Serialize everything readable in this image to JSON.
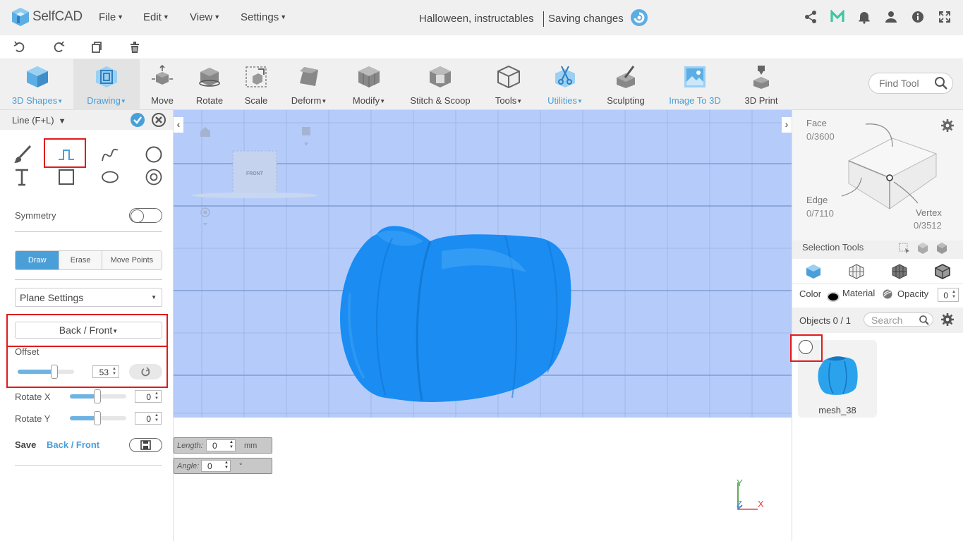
{
  "app": {
    "logo_text": "SelfCAD",
    "menus": [
      "File",
      "Edit",
      "View",
      "Settings"
    ],
    "document_title": "Halloween, instructables",
    "save_status": "Saving changes"
  },
  "ribbon": {
    "tools": [
      {
        "label": "3D Shapes",
        "dropdown": true
      },
      {
        "label": "Drawing",
        "dropdown": true
      },
      {
        "label": "Move",
        "dropdown": false
      },
      {
        "label": "Rotate",
        "dropdown": false
      },
      {
        "label": "Scale",
        "dropdown": false
      },
      {
        "label": "Deform",
        "dropdown": true
      },
      {
        "label": "Modify",
        "dropdown": true
      },
      {
        "label": "Stitch & Scoop",
        "dropdown": false
      },
      {
        "label": "Tools",
        "dropdown": true
      },
      {
        "label": "Utilities",
        "dropdown": true
      },
      {
        "label": "Sculpting",
        "dropdown": false
      },
      {
        "label": "Image To 3D",
        "dropdown": false
      },
      {
        "label": "3D Print",
        "dropdown": false
      }
    ],
    "find_tool_placeholder": "Find Tool"
  },
  "left_panel": {
    "title": "Line (F+L)",
    "symmetry_label": "Symmetry",
    "symmetry_on": false,
    "modes": [
      "Draw",
      "Erase",
      "Move Points"
    ],
    "active_mode": "Draw",
    "plane_settings": "Plane Settings",
    "plane": "Back / Front",
    "offset_label": "Offset",
    "offset_value": "53",
    "offset_fraction": 0.65,
    "rotate_x_label": "Rotate X",
    "rotate_x_value": "0",
    "rotate_y_label": "Rotate Y",
    "rotate_y_value": "0",
    "save_label": "Save",
    "save_plane": "Back / Front"
  },
  "viewport": {
    "view_cube_label": "FRONT",
    "length_label": "Length:",
    "length_value": "0",
    "length_unit": "mm",
    "angle_label": "Angle:",
    "angle_value": "0",
    "angle_unit": "°",
    "axis_y": "Y",
    "axis_z": "Z",
    "axis_x": "X"
  },
  "right_panel": {
    "face_label": "Face",
    "face_count": "0/3600",
    "edge_label": "Edge",
    "edge_count": "0/7110",
    "vertex_label": "Vertex",
    "vertex_count": "0/3512",
    "selection_tools_label": "Selection Tools",
    "color_label": "Color",
    "material_label": "Material",
    "opacity_label": "Opacity",
    "opacity_value": "0",
    "objects_label": "Objects 0 / 1",
    "search_placeholder": "Search",
    "object_name": "mesh_38"
  },
  "colors": {
    "accent": "#4a9fd8",
    "viewport_bg": "#b5ccfb",
    "mesh": "#1a8cf2",
    "highlight": "#e01b1b"
  }
}
